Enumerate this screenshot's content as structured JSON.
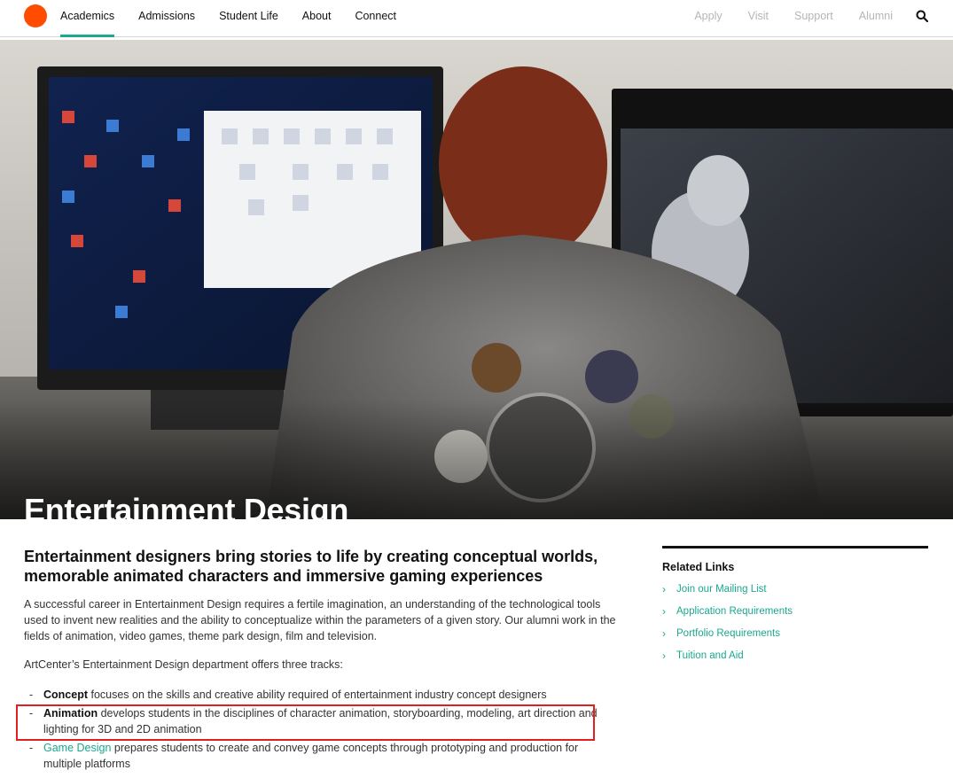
{
  "header": {
    "main_nav": [
      {
        "label": "Academics",
        "active": true
      },
      {
        "label": "Admissions",
        "active": false
      },
      {
        "label": "Student Life",
        "active": false
      },
      {
        "label": "About",
        "active": false
      },
      {
        "label": "Connect",
        "active": false
      }
    ],
    "utility_nav": [
      "Apply",
      "Visit",
      "Support",
      "Alumni"
    ],
    "search_icon": "search-icon"
  },
  "hero": {
    "title": "Entertainment Design"
  },
  "content": {
    "heading": "Entertainment designers bring stories to life by creating conceptual worlds, memorable animated characters and immersive gaming experiences",
    "paragraph1": "A successful career in Entertainment Design requires a fertile imagination, an understanding of the technological tools used to invent new realities and the ability to conceptualize within the parameters of a given story. Our alumni work in the fields of animation, video games, theme park design, film and television.",
    "paragraph2": "ArtCenter’s Entertainment Design department offers three tracks:",
    "tracks": [
      {
        "dash": "-",
        "name": "Concept",
        "text": " focuses on the skills and creative ability required of entertainment industry concept designers"
      },
      {
        "dash": "-",
        "name": "Animation",
        "text": " develops students in the disciplines of character animation, storyboarding, modeling, art direction and lighting for 3D and 2D animation"
      },
      {
        "dash": "-",
        "name": "Game Design",
        "text": " prepares students to create and convey game concepts through prototyping and production for multiple platforms"
      }
    ]
  },
  "sidebar": {
    "title": "Related Links",
    "links": [
      "Join our Mailing List",
      "Application Requirements",
      "Portfolio Requirements",
      "Tuition and Aid"
    ]
  },
  "colors": {
    "brand_orange": "#ff4c00",
    "accent_teal": "#1aa88f",
    "highlight_red": "#e02020"
  }
}
